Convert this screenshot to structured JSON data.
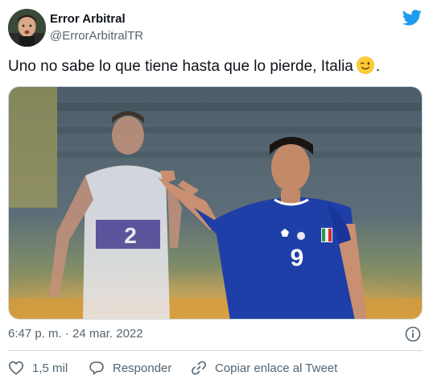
{
  "author": {
    "name": "Error Arbitral",
    "handle": "@ErrorArbitralTR"
  },
  "tweet": {
    "text_before_emoji": "Uno no sabe lo que tiene hasta que lo pierde, Italia",
    "emoji": "winking-face",
    "text_after_emoji": ".",
    "image_description": "football-photo",
    "player_front_number": "9",
    "player_back_number": "2"
  },
  "meta": {
    "timestamp": "6:47 p. m. · 24 mar. 2022"
  },
  "actions": {
    "likes": "1,5 mil",
    "reply_label": "Responder",
    "copy_label": "Copiar enlace al Tweet"
  },
  "colors": {
    "twitter_blue": "#1d9bf0",
    "text_primary": "#0f1419",
    "text_secondary": "#536471",
    "italy_blue": "#1f3fa8"
  }
}
